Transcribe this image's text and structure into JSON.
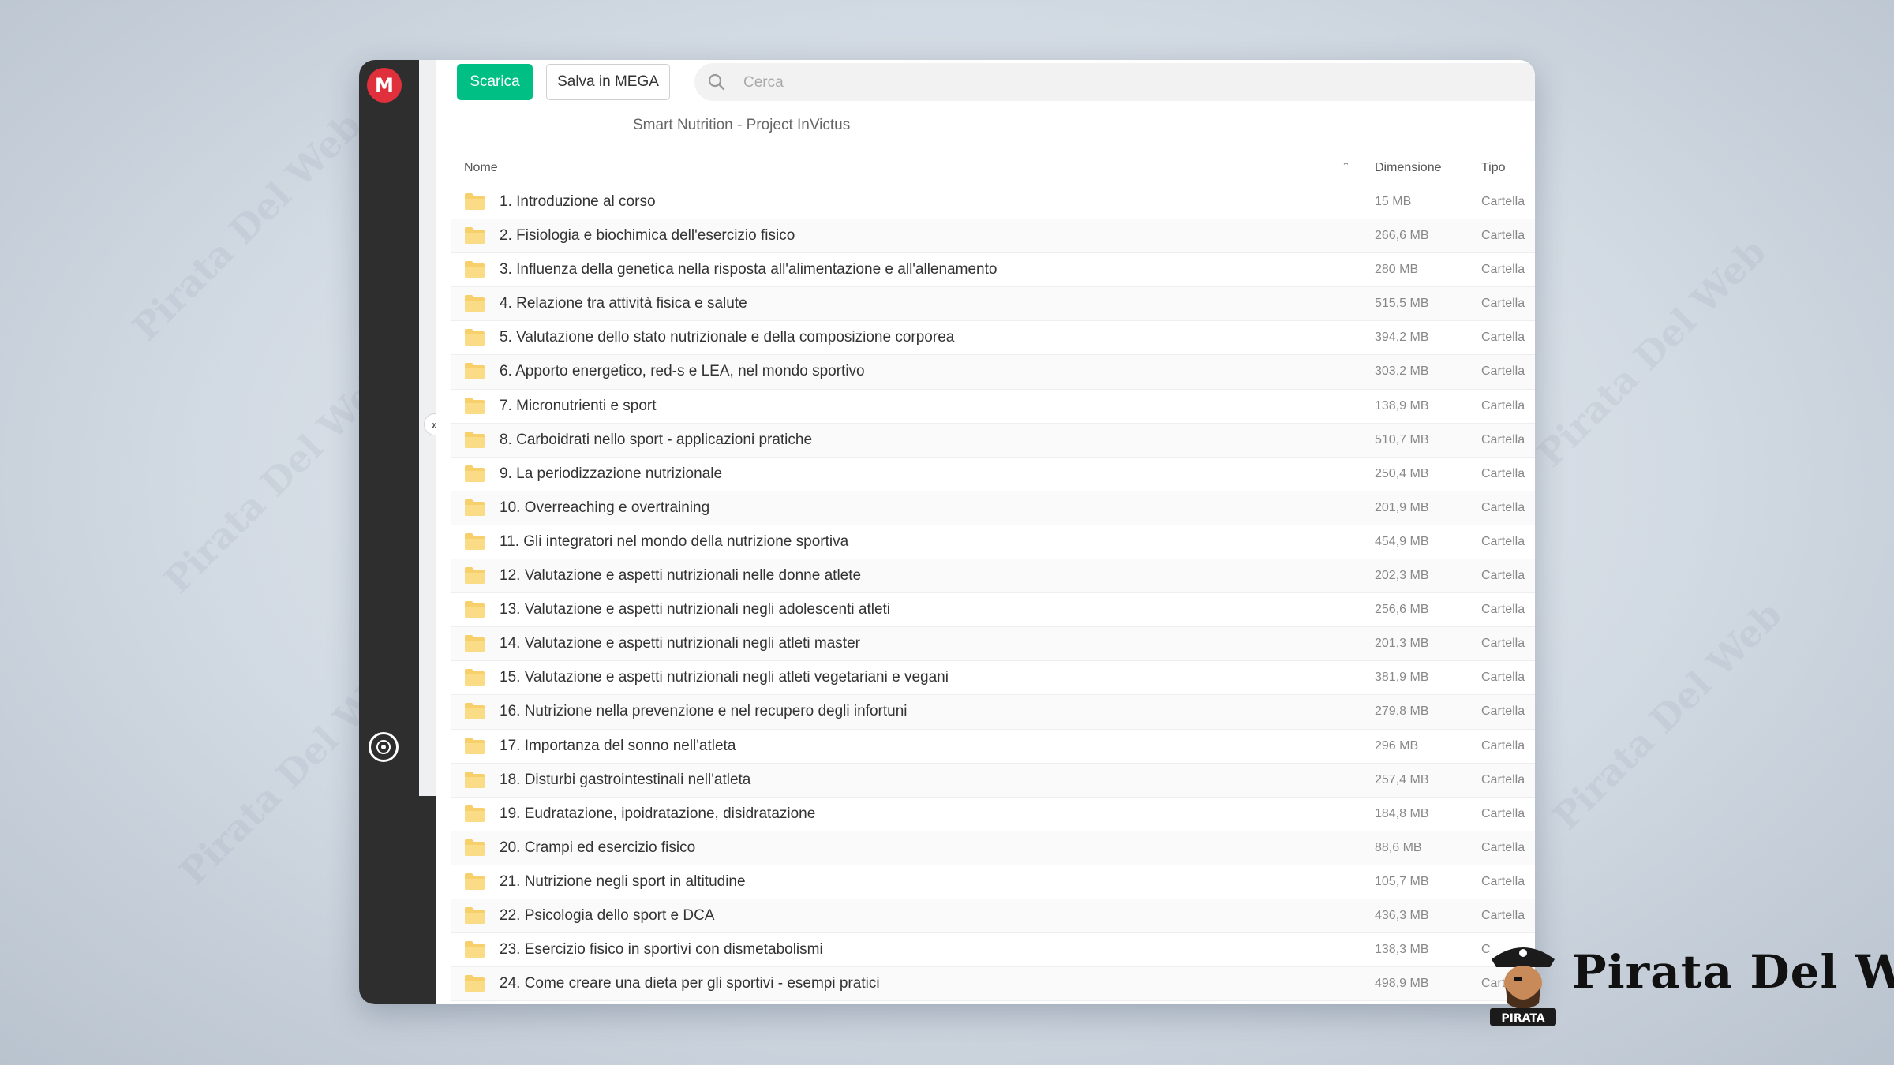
{
  "app": {
    "logo_letter": "M",
    "brand_color": "#e0303c"
  },
  "toolbar": {
    "download_label": "Scarica",
    "download_color": "#00bf84",
    "save_label": "Salva in MEGA"
  },
  "search": {
    "placeholder": "Cerca",
    "value": ""
  },
  "folder": {
    "title": "Smart Nutrition - Project InVictus"
  },
  "table": {
    "columns": {
      "name": "Nome",
      "sort_icon": "chevron-up-icon",
      "size": "Dimensione",
      "type": "Tipo"
    },
    "rows": [
      {
        "name": "1. Introduzione al corso",
        "size": "15 MB",
        "type": "Cartella"
      },
      {
        "name": "2. Fisiologia e biochimica dell'esercizio fisico",
        "size": "266,6 MB",
        "type": "Cartella"
      },
      {
        "name": "3. Influenza della genetica nella risposta all'alimentazione e all'allenamento",
        "size": "280 MB",
        "type": "Cartella"
      },
      {
        "name": "4. Relazione tra attività fisica e salute",
        "size": "515,5 MB",
        "type": "Cartella"
      },
      {
        "name": "5. Valutazione dello stato nutrizionale e della composizione corporea",
        "size": "394,2 MB",
        "type": "Cartella"
      },
      {
        "name": "6. Apporto energetico, red-s e LEA, nel mondo sportivo",
        "size": "303,2 MB",
        "type": "Cartella"
      },
      {
        "name": "7. Micronutrienti e sport",
        "size": "138,9 MB",
        "type": "Cartella"
      },
      {
        "name": "8. Carboidrati nello sport - applicazioni pratiche",
        "size": "510,7 MB",
        "type": "Cartella"
      },
      {
        "name": "9. La periodizzazione nutrizionale",
        "size": "250,4 MB",
        "type": "Cartella"
      },
      {
        "name": "10. Overreaching e overtraining",
        "size": "201,9 MB",
        "type": "Cartella"
      },
      {
        "name": "11. Gli integratori nel mondo della nutrizione sportiva",
        "size": "454,9 MB",
        "type": "Cartella"
      },
      {
        "name": "12. Valutazione e aspetti nutrizionali nelle donne atlete",
        "size": "202,3 MB",
        "type": "Cartella"
      },
      {
        "name": "13. Valutazione e aspetti nutrizionali negli adolescenti atleti",
        "size": "256,6 MB",
        "type": "Cartella"
      },
      {
        "name": "14. Valutazione e aspetti nutrizionali negli atleti master",
        "size": "201,3 MB",
        "type": "Cartella"
      },
      {
        "name": "15. Valutazione e aspetti nutrizionali negli atleti vegetariani e vegani",
        "size": "381,9 MB",
        "type": "Cartella"
      },
      {
        "name": "16. Nutrizione nella prevenzione e nel recupero degli infortuni",
        "size": "279,8 MB",
        "type": "Cartella"
      },
      {
        "name": "17. Importanza del sonno nell'atleta",
        "size": "296 MB",
        "type": "Cartella"
      },
      {
        "name": "18. Disturbi gastrointestinali nell'atleta",
        "size": "257,4 MB",
        "type": "Cartella"
      },
      {
        "name": "19. Eudratazione, ipoidratazione, disidratazione",
        "size": "184,8 MB",
        "type": "Cartella"
      },
      {
        "name": "20. Crampi ed esercizio fisico",
        "size": "88,6 MB",
        "type": "Cartella"
      },
      {
        "name": "21. Nutrizione negli sport in altitudine",
        "size": "105,7 MB",
        "type": "Cartella"
      },
      {
        "name": "22. Psicologia dello sport e DCA",
        "size": "436,3 MB",
        "type": "Cartella"
      },
      {
        "name": "23. Esercizio fisico in sportivi con dismetabolismi",
        "size": "138,3 MB",
        "type": "C"
      },
      {
        "name": "24. Come creare una dieta per gli sportivi - esempi pratici",
        "size": "498,9 MB",
        "type": "Carte"
      }
    ]
  },
  "watermark": {
    "text": "Pirata Del Web",
    "badge_text": "PIRATA"
  }
}
